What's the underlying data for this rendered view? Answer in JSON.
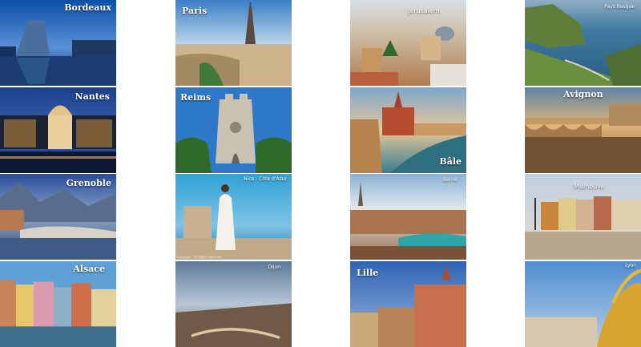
{
  "tiles": [
    {
      "label": "Bordeaux"
    },
    {
      "label": "Paris"
    },
    {
      "label": "Jerusalem"
    },
    {
      "label": "Pays Basque"
    },
    {
      "label": "Nantes"
    },
    {
      "label": "Reims"
    },
    {
      "label": "Bâle"
    },
    {
      "label": "Avignon"
    },
    {
      "label": "Grenoble"
    },
    {
      "label": "Nice - Côte d'Azur"
    },
    {
      "label": "Berne"
    },
    {
      "label": "Mulhouse"
    },
    {
      "label": "Alsace"
    },
    {
      "label": "Dijon"
    },
    {
      "label": "Lille"
    },
    {
      "label": "Lyon"
    }
  ],
  "credit": "Copyright – All Rights Reserved"
}
